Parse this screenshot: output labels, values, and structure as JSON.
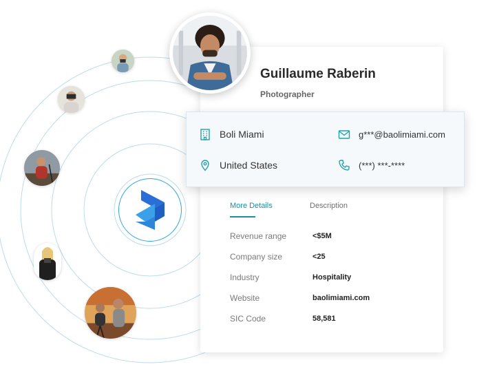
{
  "profile": {
    "name": "Guillaume Raberin",
    "title": "Photographer"
  },
  "contact": {
    "company": "Boli Miami",
    "email": "g***@baolimiami.com",
    "location": "United States",
    "phone": "(***) ***-****"
  },
  "tabs": [
    {
      "label": "More Details",
      "active": true
    },
    {
      "label": "Description",
      "active": false
    }
  ],
  "details": [
    {
      "label": "Revenue range",
      "value": "<$5M"
    },
    {
      "label": "Company size",
      "value": "<25"
    },
    {
      "label": "Industry",
      "value": "Hospitality"
    },
    {
      "label": "Website",
      "value": "baolimiami.com"
    },
    {
      "label": "SIC Code",
      "value": "58,581"
    }
  ],
  "colors": {
    "accent": "#1a8fa0",
    "icon": "#1fa3a8",
    "ring": "#b9dcef",
    "logo": "#2aa4e0"
  },
  "icons": {
    "company": "building-icon",
    "email": "envelope-icon",
    "location": "map-pin-icon",
    "phone": "phone-icon",
    "logo": "brand-logo-icon"
  }
}
